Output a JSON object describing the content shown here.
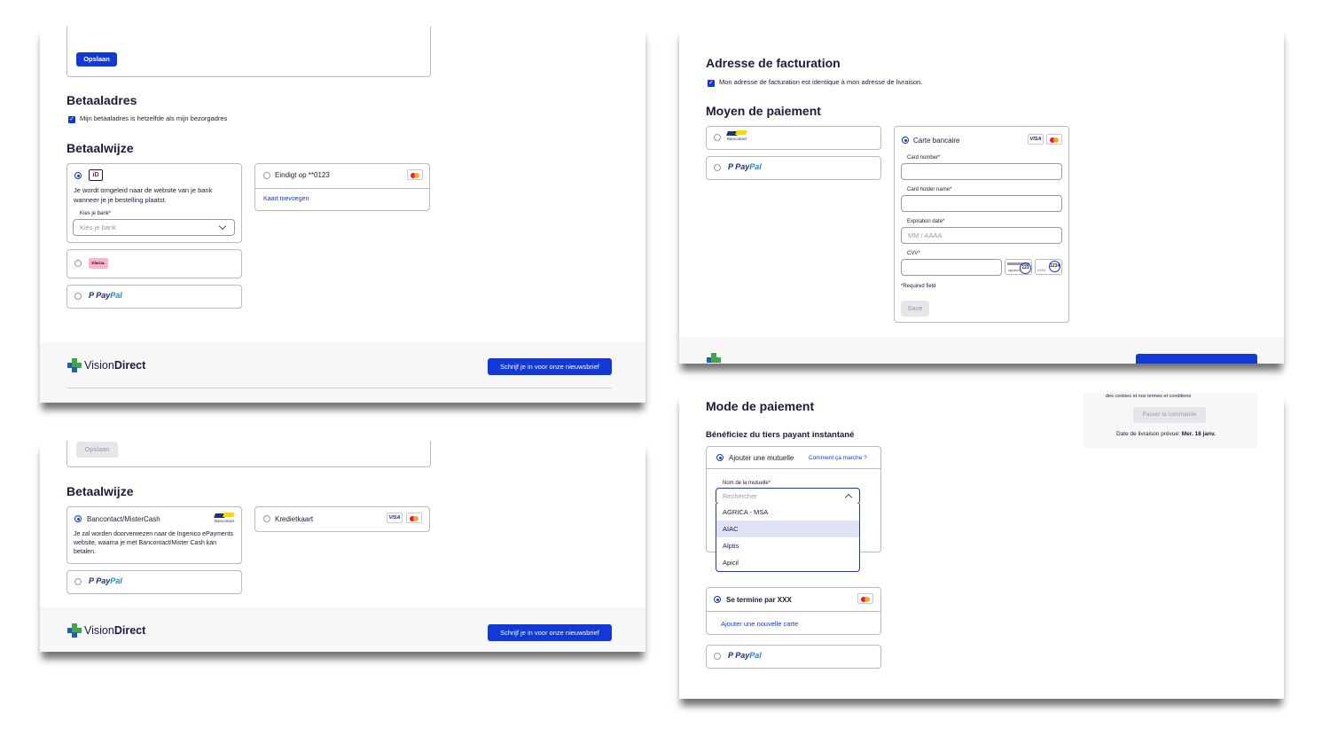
{
  "panel_nl_1": {
    "save_button": "Opslaan",
    "billing_title": "Betaaladres",
    "same_address_label": "Mijn betaaladres is hetzelfde als mijn bezorgadres",
    "payment_title": "Betaalwijze",
    "ideal_description": "Je wordt omgeleid naar de website van je bank wanneer je je bestelling plaatst.",
    "bank_label": "Kies je bank*",
    "bank_placeholder": "Kies je bank",
    "klarna_label": "Klarna.",
    "saved_card_label": "Eindigt op **0123",
    "add_card_link": "Kaart toevoegen",
    "paypal_a": "P",
    "paypal_b": "Pay",
    "paypal_c": "Pal"
  },
  "panel_nl_2": {
    "save_button": "Opslaan",
    "payment_title": "Betaalwijze",
    "bancontact_label": "Bancontact/MisterCash",
    "bancontact_description": "Je zal worden doorverwezen naar de Ingenico ePayments website, waarna je met Bancontact/Mister Cash kan betalen.",
    "creditcard_label": "Kredietkaart"
  },
  "footer": {
    "logo_vision": "Vision",
    "logo_direct": "Direct",
    "newsletter_button": "Schrijf je in voor onze nieuwsbrief"
  },
  "brand_logos": {
    "bancontact": "Bancontact",
    "visa": "VISA"
  },
  "panel_fr_1": {
    "billing_title": "Adresse de facturation",
    "same_address_label": "Mon adresse de facturation est identique à mon adresse de livraison.",
    "payment_title": "Moyen de paiement",
    "card_label": "Carte bancaire",
    "card_number_label": "Card number*",
    "card_holder_label": "Card holder name*",
    "expiration_label": "Expiration date*",
    "expiration_placeholder": "MM / AAAA",
    "cvv_label": "CVV*",
    "cvv_3": "123",
    "cvv_4": "1234",
    "cvv_sig": "signature",
    "cvv_xxxx": "XXXX",
    "required_note": "*Required field",
    "save_button": "Save"
  },
  "panel_fr_2": {
    "payment_title": "Mode de paiement",
    "tiers_title": "Bénéficiez du tiers payant instantané",
    "mutuelle_label": "Ajouter une mutuelle",
    "how_link": "Comment ça marche ?",
    "mutuelle_field_label": "Nom de la mutuelle*",
    "search_placeholder": "Rechercher",
    "options": [
      "AGRICA - MSA",
      "AIAC",
      "Alptis",
      "Apicil"
    ],
    "saved_card_label": "Se termine par XXX",
    "add_card_link": "Ajouter une nouvelle carte",
    "cookies_text": "des cookies et nos termes et conditions",
    "order_button": "Passer la commande",
    "delivery_label": "Date de livraison prévue:",
    "delivery_date": "Mer. 18 janv."
  },
  "colors": {
    "accent": "#1238d6",
    "text": "#1b1b3a",
    "border": "#b9b9c3",
    "logo_green": "#3ea848"
  }
}
